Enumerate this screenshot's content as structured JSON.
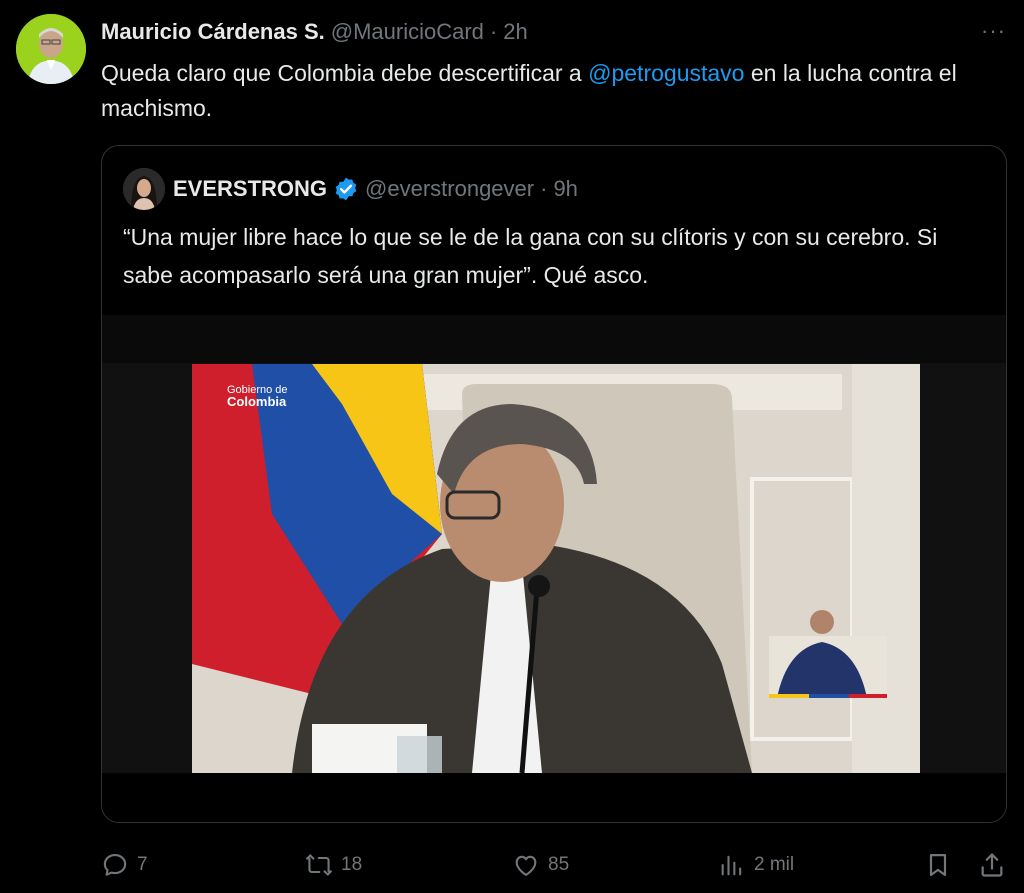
{
  "author": {
    "name": "Mauricio Cárdenas S.",
    "handle": "@MauricioCard",
    "separator": "·",
    "time": "2h"
  },
  "more_label": "···",
  "tweet": {
    "text_before": "Queda claro que Colombia debe descertificar a ",
    "mention": "@petrogustavo",
    "text_after": " en la lucha contra el machismo."
  },
  "quoted": {
    "name": "EVERSTRONG",
    "handle": "@everstrongever",
    "separator": "·",
    "time": "9h",
    "text": "“Una mujer libre hace lo que se le de la gana con su clítoris y con su cerebro.  Si sabe acompasarlo será una gran mujer”.  Qué asco.",
    "media": {
      "logo_line1": "Gobierno de",
      "logo_line2": "Colombia"
    }
  },
  "actions": {
    "replies": "7",
    "reposts": "18",
    "likes": "85",
    "views": "2 mil"
  },
  "colors": {
    "background": "#000000",
    "text": "#e7e9ea",
    "muted": "#71767b",
    "link": "#1d9bf0",
    "border": "#2f3336"
  }
}
